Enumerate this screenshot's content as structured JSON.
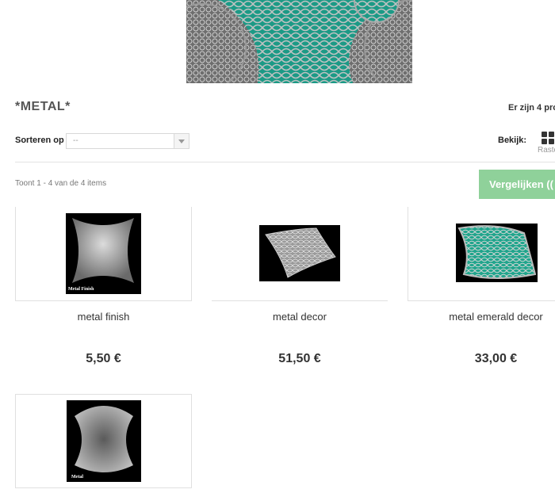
{
  "category": {
    "title": "*METAL*",
    "product_count_text": "Er zijn 4 pro"
  },
  "toolbar": {
    "sort_label": "Sorteren op",
    "sort_value": "--",
    "view_label": "Bekijk:",
    "view_mode": "Raste",
    "showing_text": "Toont 1 - 4 van de 4 items",
    "compare_button": "Vergelijken (("
  },
  "products": [
    {
      "name": "metal finish",
      "price": "5,50 €",
      "thumb_caption": "Metal Finish"
    },
    {
      "name": "metal decor",
      "price": "51,50 €",
      "thumb_caption": ""
    },
    {
      "name": "metal emerald decor",
      "price": "33,00 €",
      "thumb_caption": ""
    },
    {
      "name": "",
      "price": "",
      "thumb_caption": "Metal"
    }
  ],
  "colors": {
    "compare_button_bg": "#8fd19a",
    "emerald": "#1fa58c"
  }
}
